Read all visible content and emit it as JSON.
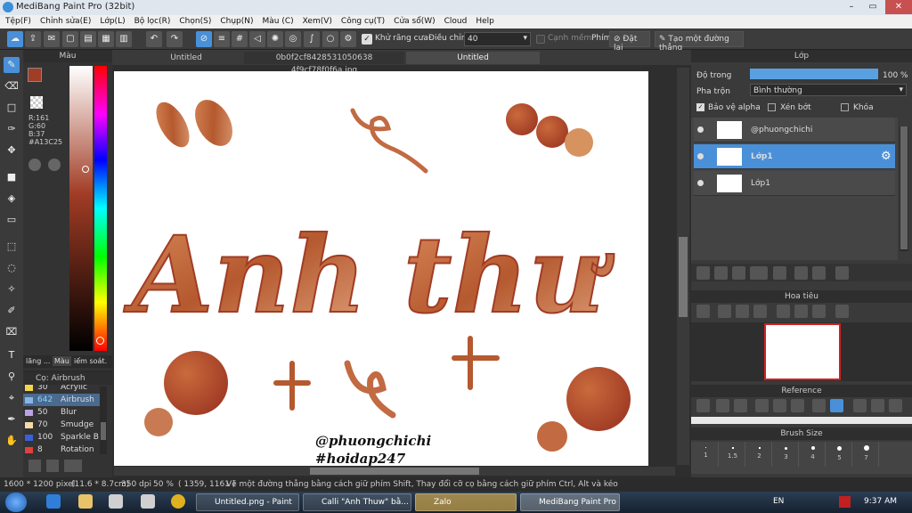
{
  "window": {
    "title": "MediBang Paint Pro (32bit)",
    "minimize": "–",
    "maximize": "▭",
    "close": "✕"
  },
  "menu": [
    "Tệp(F)",
    "Chỉnh sửa(E)",
    "Lớp(L)",
    "Bộ lọc(R)",
    "Chọn(S)",
    "Chụp(N)",
    "Màu (C)",
    "Xem(V)",
    "Công cụ(T)",
    "Cửa sổ(W)",
    "Cloud",
    "Help"
  ],
  "toolbar": {
    "antialias_label": "Khử răng cưa",
    "adjust_label": "Điều chỉnh",
    "adjust_value": "40",
    "snap_label": "Cạnh mềm",
    "brush_label": "Phím",
    "reset_label": "Đặt lại",
    "line_label": "Tạo một đường thẳng"
  },
  "color_panel": {
    "title": "Màu",
    "r": "R:161",
    "g": "G:60",
    "b": "B:37",
    "hex": "#A13C25",
    "fg_color": "#A13C25",
    "tabs": [
      "lãng ...",
      "Màu",
      "iếm soát."
    ]
  },
  "brush_panel": {
    "title": "Cọ: Airbrush",
    "items": [
      {
        "size": "30",
        "name": "Acrylic",
        "color": "#f2d64b"
      },
      {
        "size": "642",
        "name": "Airbrush",
        "color": "#8ab4e8",
        "selected": true
      },
      {
        "size": "50",
        "name": "Blur",
        "color": "#b9a3e0"
      },
      {
        "size": "70",
        "name": "Smudge",
        "color": "#f5d9a8"
      },
      {
        "size": "100",
        "name": "Sparkle B",
        "color": "#3a5fd8"
      },
      {
        "size": "8",
        "name": "Rotation",
        "color": "#e04040"
      }
    ]
  },
  "tabs": {
    "left": "Untitled",
    "middle": "0b0f2cf8428531050638 4f9cf78f0f6a.jpg",
    "right": "Untitled"
  },
  "canvas": {
    "credit1": "@phuongchichi",
    "credit2": "#hoidap247",
    "lettering1": "Anh",
    "lettering2": "thư"
  },
  "layers_panel": {
    "title": "Lớp",
    "opacity_label": "Độ trong",
    "opacity_value": "100 %",
    "opacity_fraction": 1.0,
    "blend_label": "Pha trộn",
    "blend_value": "Bình thường",
    "protect_alpha": "Bảo vệ alpha",
    "clipping": "Xén bớt",
    "lock": "Khóa",
    "layers": [
      {
        "name": "@phuongchichi",
        "selected": false
      },
      {
        "name": "Lớp1",
        "selected": true
      },
      {
        "name": "Lớp1",
        "selected": false
      }
    ]
  },
  "navigator": {
    "title": "Hoa tiêu"
  },
  "reference": {
    "title": "Reference"
  },
  "brush_size": {
    "title": "Brush Size",
    "sizes": [
      "1",
      "1.5",
      "2",
      "3",
      "4",
      "5",
      "7"
    ]
  },
  "status": {
    "dimensions": "1600 * 1200 pixel",
    "physical": "(11.6 * 8.7cm)",
    "dpi": "350 dpi",
    "zoom": "50 %",
    "coords": "( 1359, 1161 )",
    "hint": "Vẽ một đường thẳng bằng cách giữ phím Shift, Thay đổi cỡ cọ bằng cách giữ phím Ctrl, Alt và kéo"
  },
  "taskbar": {
    "tasks": [
      "Untitled.png - Paint",
      "Calli \"Anh Thuw\" bằ...",
      "Zalo",
      "MediBang Paint Pro ..."
    ],
    "lang": "EN",
    "time": "9:37 AM"
  }
}
